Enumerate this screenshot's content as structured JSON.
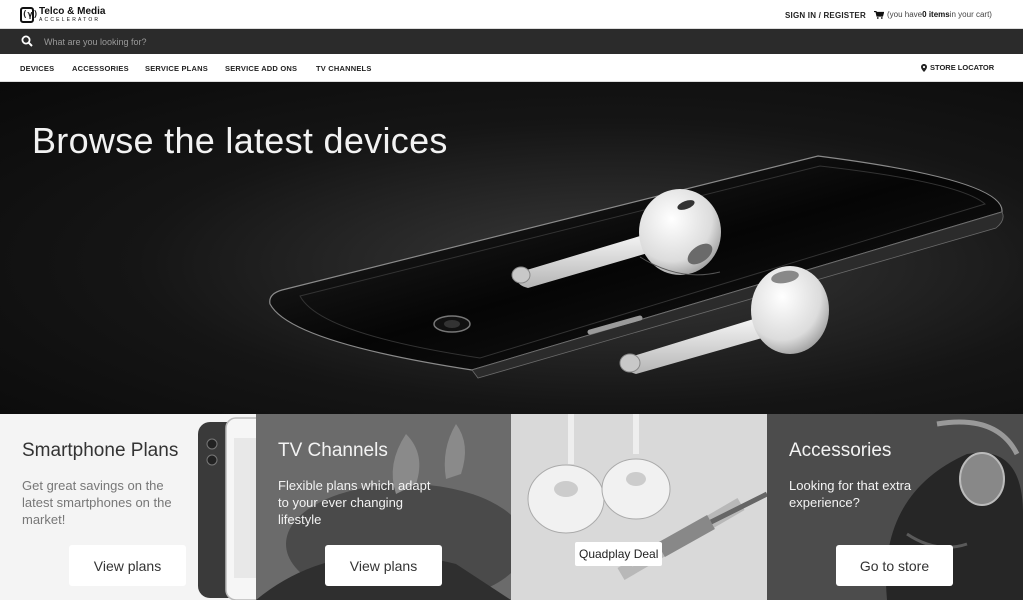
{
  "header": {
    "logo_title": "Telco & Media",
    "logo_sub": "ACCELERATOR",
    "logo_glyph": "(γ)",
    "signin_label": "SIGN IN / REGISTER",
    "cart_prefix": "(you have ",
    "cart_count": "0",
    "cart_items_word": "items",
    "cart_suffix": " in your cart)"
  },
  "search": {
    "placeholder": "What are you looking for?"
  },
  "nav": {
    "items": [
      {
        "label": "DEVICES"
      },
      {
        "label": "ACCESSORIES"
      },
      {
        "label": "SERVICE PLANS"
      },
      {
        "label": "SERVICE ADD ONS"
      },
      {
        "label": "TV CHANNELS"
      }
    ],
    "store_locator": "STORE LOCATOR"
  },
  "hero": {
    "title": "Browse the latest devices"
  },
  "tiles": [
    {
      "title": "Smartphone Plans",
      "text": "Get great savings on the latest smartphones on the market!",
      "button": "View plans"
    },
    {
      "title": "TV Channels",
      "text": "Flexible plans which adapt to your ever changing lifestyle",
      "button": "View plans"
    },
    {
      "label": "Quadplay Deal"
    },
    {
      "title": "Accessories",
      "text": "Looking for that extra experience?",
      "button": "Go to store"
    }
  ],
  "colors": {
    "search_bg": "#2b2b2b",
    "hero_bg": "#111111",
    "tile1_bg": "#f4f4f4",
    "tile2_bg": "#6b6b6b",
    "tile3_bg": "#d9d9d9",
    "tile4_bg": "#4c4c4c"
  }
}
